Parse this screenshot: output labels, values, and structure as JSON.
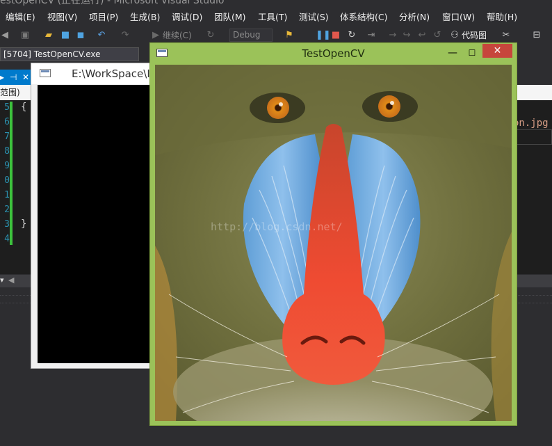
{
  "vs": {
    "title": "estOpenCV (正在运行) - Microsoft Visual Studio",
    "menu": [
      "编辑(E)",
      "视图(V)",
      "项目(P)",
      "生成(B)",
      "调试(D)",
      "团队(M)",
      "工具(T)",
      "测试(S)",
      "体系结构(C)",
      "分析(N)",
      "窗口(W)",
      "帮助(H)"
    ],
    "toolbar": {
      "continue_label": "继续(C)",
      "config_value": "Debug",
      "codemap_label": "代码图"
    },
    "process_value": "[5704] TestOpenCV.exe",
    "scope_label": "范围)",
    "line_numbers": [
      "5",
      "6",
      "7",
      "8",
      "9",
      "0",
      "1",
      "2",
      "3",
      "4"
    ],
    "code_fragment": "on.jpg",
    "brace_open": "{",
    "brace_close": "}"
  },
  "console": {
    "title": "E:\\WorkSpace\\I"
  },
  "cvwindow": {
    "title": "TestOpenCV",
    "watermark": "http://blog.csdn.net/",
    "minimize": "—",
    "maximize": "☐",
    "close": "✕"
  },
  "colors": {
    "vs_bg": "#2d2d30",
    "vs_accent": "#007acc",
    "cv_frame": "#9bc259",
    "close_red": "#c7463c"
  }
}
